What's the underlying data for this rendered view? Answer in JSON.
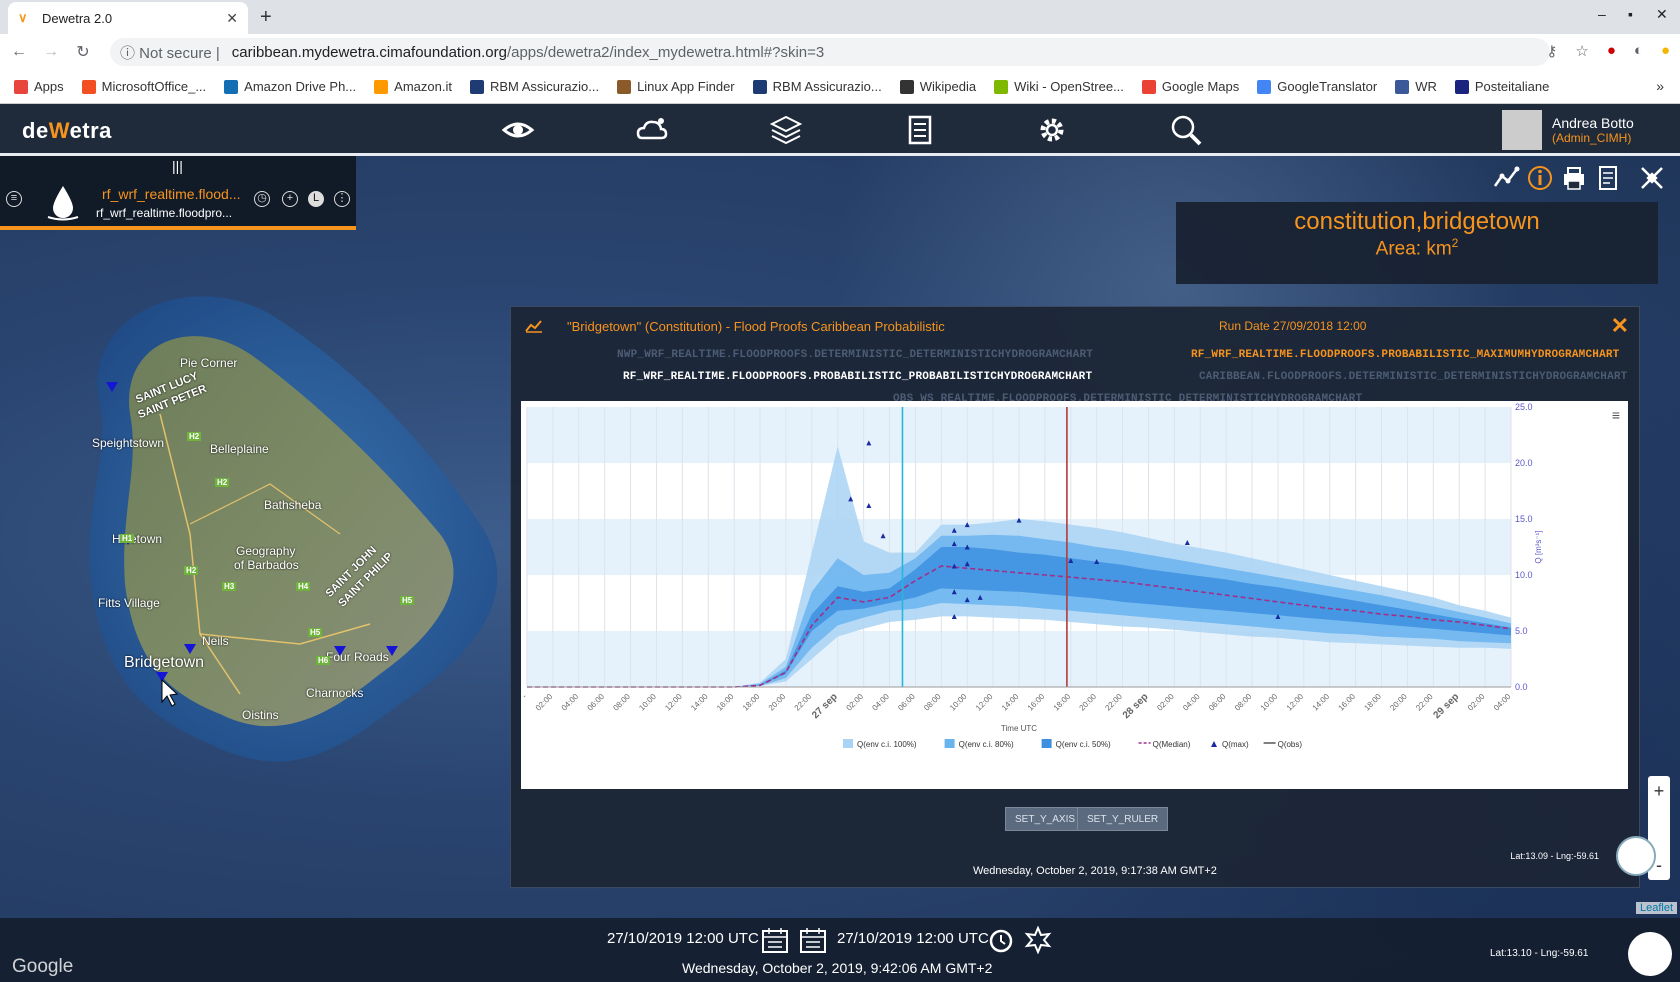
{
  "browser": {
    "tab_title": "Dewetra 2.0",
    "url_security": "Not secure",
    "url_host": "caribbean.mydewetra.cimafoundation.org",
    "url_path": "/apps/dewetra2/index_mydewetra.html#?skin=3",
    "bookmarks": [
      "Apps",
      "MicrosoftOffice_...",
      "Amazon Drive Ph...",
      "Amazon.it",
      "RBM Assicurazio...",
      "Linux App Finder",
      "RBM Assicurazio...",
      "Wikipedia",
      "Wiki - OpenStree...",
      "Google Maps",
      "GoogleTranslator",
      "WR",
      "Posteitaliane"
    ]
  },
  "app": {
    "logo": "dewetra",
    "user_name": "Andrea Botto",
    "user_role": "(Admin_CIMH)",
    "layer_name": "rf_wrf_realtime.flood...",
    "layer_sub": "rf_wrf_realtime.floodpro..."
  },
  "info": {
    "title": "constitution,bridgetown",
    "area_label": "Area: km",
    "area_sup": "2"
  },
  "map": {
    "places": [
      "Pie Corner",
      "SAINT LUCY",
      "SAINT PETER",
      "Speightstown",
      "Belleplaine",
      "Bathsheba",
      "Holetown",
      "Geography",
      "of Barbados",
      "SAINT JOHN",
      "SAINT PHILIP",
      "Fitts Village",
      "Neils",
      "Bridgetown",
      "Four Roads",
      "Charnocks",
      "Oistins"
    ],
    "roads": [
      "H2",
      "H2",
      "H1",
      "H2",
      "H3",
      "H4",
      "H5",
      "H5",
      "H6"
    ]
  },
  "chart_window": {
    "title": "\"Bridgetown\" (Constitution) - Flood Proofs Caribbean Probabilistic",
    "run_date": "Run Date 27/09/2018 12:00",
    "tabs": {
      "det": "NWP_WRF_REALTIME.FLOODPROOFS.DETERMINISTIC_DETERMINISTICHYDROGRAMCHART",
      "max": "RF_WRF_REALTIME.FLOODPROOFS.PROBABILISTIC_MAXIMUMHYDROGRAMCHART",
      "prob": "RF_WRF_REALTIME.FLOODPROOFS.PROBABILISTIC_PROBABILISTICHYDROGRAMCHART",
      "carib": "CARIBBEAN.FLOODPROOFS.DETERMINISTIC_DETERMINISTICHYDROGRAMCHART",
      "obs": "OBS_WS_REALTIME.FLOODPROOFS.DETERMINISTIC_DETERMINISTICHYDROGRAMCHART"
    },
    "btn_y_axis": "SET_Y_AXIS",
    "btn_y_ruler": "SET_Y_RULER",
    "date_text": "Wednesday, October 2, 2019, 9:17:38 AM GMT+2",
    "latlon": "Lat:13.09 - Lng:-59.61"
  },
  "chart_data": {
    "type": "area",
    "xlabel": "Time UTC",
    "ylabel": "Q [m³s⁻¹]",
    "ylim": [
      0,
      25
    ],
    "y_ticks": [
      "0.0",
      "5.0",
      "10.0",
      "15.0",
      "20.0",
      "25.0"
    ],
    "x_ticks": [
      "-",
      "02:00",
      "04:00",
      "06:00",
      "08:00",
      "10:00",
      "12:00",
      "14:00",
      "16:00",
      "18:00",
      "20:00",
      "22:00",
      "27 sep",
      "02:00",
      "04:00",
      "06:00",
      "08:00",
      "10:00",
      "12:00",
      "14:00",
      "16:00",
      "18:00",
      "20:00",
      "22:00",
      "28 sep",
      "02:00",
      "04:00",
      "06:00",
      "08:00",
      "10:00",
      "12:00",
      "14:00",
      "16:00",
      "18:00",
      "20:00",
      "22:00",
      "29 sep",
      "02:00",
      "04:00"
    ],
    "x_hours": [
      0,
      5,
      10,
      14,
      16,
      18,
      20,
      22,
      24,
      26,
      28,
      30,
      32,
      34,
      36,
      38,
      40,
      42,
      44,
      46,
      48,
      50,
      52,
      54,
      56,
      58,
      60,
      62,
      64,
      66,
      68,
      70,
      72,
      74,
      76
    ],
    "series": [
      {
        "name": "Q(env c.i. 100%)",
        "color": "#a9d4f5",
        "lower": [
          0,
          0,
          0,
          0,
          0,
          0.1,
          0.5,
          2.5,
          4.5,
          5.2,
          5.8,
          6.0,
          6.3,
          6.3,
          6.2,
          6.1,
          6.0,
          5.8,
          5.6,
          5.4,
          5.3,
          5.1,
          4.9,
          4.7,
          4.5,
          4.4,
          4.2,
          4.0,
          3.9,
          3.8,
          3.7,
          3.6,
          3.5,
          3.5,
          3.4
        ],
        "upper": [
          0,
          0,
          0,
          0,
          0,
          0.4,
          2.5,
          12.0,
          21.5,
          13.0,
          12.0,
          12.0,
          14.5,
          14.5,
          14.7,
          15.0,
          14.8,
          14.5,
          14.2,
          13.8,
          13.3,
          12.8,
          12.4,
          12.0,
          11.5,
          11.0,
          10.5,
          10.0,
          9.5,
          9.0,
          8.5,
          8.0,
          7.3,
          6.8,
          6.2
        ]
      },
      {
        "name": "Q(env c.i. 80%)",
        "color": "#6ab4ee",
        "lower": [
          0,
          0,
          0,
          0,
          0,
          0.1,
          0.8,
          3.5,
          5.5,
          6.2,
          6.8,
          7.0,
          7.5,
          7.4,
          7.3,
          7.2,
          7.0,
          6.8,
          6.6,
          6.4,
          6.2,
          6.0,
          5.8,
          5.6,
          5.4,
          5.2,
          5.0,
          4.8,
          4.7,
          4.5,
          4.4,
          4.3,
          4.1,
          4.0,
          3.9
        ],
        "upper": [
          0,
          0,
          0,
          0,
          0,
          0.3,
          1.8,
          8.5,
          11.5,
          10.0,
          10.2,
          11.5,
          13.5,
          13.5,
          13.6,
          13.5,
          13.2,
          12.9,
          12.5,
          12.2,
          11.8,
          11.4,
          11.0,
          10.6,
          10.2,
          9.8,
          9.4,
          9.0,
          8.6,
          8.2,
          7.7,
          7.2,
          6.7,
          6.2,
          5.7
        ]
      },
      {
        "name": "Q(env c.i. 50%)",
        "color": "#3d8fe0",
        "lower": [
          0,
          0,
          0,
          0,
          0,
          0.15,
          1.2,
          5.0,
          6.8,
          7.0,
          7.5,
          8.0,
          8.8,
          8.7,
          8.6,
          8.5,
          8.3,
          8.1,
          7.9,
          7.6,
          7.4,
          7.2,
          7.0,
          6.8,
          6.6,
          6.4,
          6.2,
          6.0,
          5.8,
          5.6,
          5.4,
          5.2,
          5.0,
          4.8,
          4.6
        ],
        "upper": [
          0,
          0,
          0,
          0,
          0,
          0.2,
          1.5,
          6.5,
          9.0,
          8.5,
          8.8,
          10.5,
          12.5,
          12.5,
          12.3,
          12.0,
          11.8,
          11.5,
          11.2,
          10.9,
          10.5,
          10.2,
          9.9,
          9.6,
          9.2,
          8.9,
          8.5,
          8.1,
          7.7,
          7.3,
          6.9,
          6.5,
          6.1,
          5.7,
          5.3
        ]
      },
      {
        "name": "Q(Median)",
        "color": "#a0308a",
        "values": [
          0,
          0,
          0,
          0,
          0,
          0.15,
          1.3,
          5.5,
          8.0,
          7.6,
          8.0,
          9.5,
          10.8,
          10.6,
          10.4,
          10.2,
          10.0,
          9.8,
          9.6,
          9.4,
          9.1,
          8.8,
          8.5,
          8.2,
          7.9,
          7.6,
          7.3,
          7.0,
          6.8,
          6.5,
          6.3,
          6.0,
          5.8,
          5.5,
          5.2
        ]
      },
      {
        "name": "Q(max)",
        "color": "#1a2aa0",
        "points": [
          [
            25,
            16.8
          ],
          [
            26.4,
            21.8
          ],
          [
            26.4,
            16.2
          ],
          [
            27.5,
            13.5
          ],
          [
            33,
            14.0
          ],
          [
            33,
            12.8
          ],
          [
            33,
            10.8
          ],
          [
            33,
            8.5
          ],
          [
            33,
            6.3
          ],
          [
            34,
            14.5
          ],
          [
            34,
            12.5
          ],
          [
            34,
            11.0
          ],
          [
            34,
            7.8
          ],
          [
            35,
            8.0
          ],
          [
            38,
            14.9
          ],
          [
            42,
            11.3
          ],
          [
            44,
            11.2
          ],
          [
            51,
            12.9
          ],
          [
            58,
            6.3
          ]
        ]
      },
      {
        "name": "Q(obs)",
        "color": "#555555",
        "values": []
      }
    ],
    "markers": [
      {
        "hour": 29,
        "color": "#24b8d8"
      },
      {
        "hour": 41.7,
        "color": "#b23a3a"
      }
    ]
  },
  "bottom": {
    "time_from": "27/10/2019 12:00 UTC",
    "time_to": "27/10/2019 12:00 UTC",
    "date_text": "Wednesday, October 2, 2019, 9:42:06 AM GMT+2",
    "latlon": "Lat:13.10 - Lng:-59.61",
    "leaflet": "Leaflet",
    "google": "Google"
  }
}
